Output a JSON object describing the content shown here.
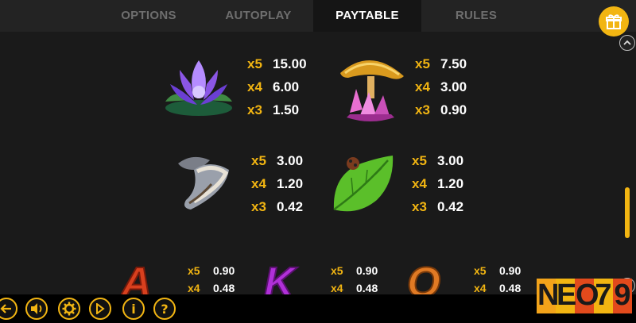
{
  "tabs": [
    {
      "label": "OPTIONS"
    },
    {
      "label": "AUTOPLAY"
    },
    {
      "label": "PAYTABLE",
      "active": true
    },
    {
      "label": "RULES"
    }
  ],
  "paytable": {
    "lotus": [
      {
        "m": "x5",
        "v": "15.00"
      },
      {
        "m": "x4",
        "v": "6.00"
      },
      {
        "m": "x3",
        "v": "1.50"
      }
    ],
    "mushroom": [
      {
        "m": "x5",
        "v": "7.50"
      },
      {
        "m": "x4",
        "v": "3.00"
      },
      {
        "m": "x3",
        "v": "0.90"
      }
    ],
    "shell": [
      {
        "m": "x5",
        "v": "3.00"
      },
      {
        "m": "x4",
        "v": "1.20"
      },
      {
        "m": "x3",
        "v": "0.42"
      }
    ],
    "leaf": [
      {
        "m": "x5",
        "v": "3.00"
      },
      {
        "m": "x4",
        "v": "1.20"
      },
      {
        "m": "x3",
        "v": "0.42"
      }
    ],
    "letter_a": [
      {
        "m": "x5",
        "v": "0.90"
      },
      {
        "m": "x4",
        "v": "0.48"
      }
    ],
    "letter_k": [
      {
        "m": "x5",
        "v": "0.90"
      },
      {
        "m": "x4",
        "v": "0.48"
      }
    ],
    "letter_q": [
      {
        "m": "x5",
        "v": "0.90"
      },
      {
        "m": "x4",
        "v": "0.48"
      }
    ]
  },
  "symbols": {
    "letter_a": "A",
    "letter_k": "K",
    "letter_q": "Q"
  },
  "controls": [
    {
      "icon": "back-arrow-icon"
    },
    {
      "icon": "sound-icon"
    },
    {
      "icon": "settings-gear-icon"
    },
    {
      "icon": "forward-arrow-icon"
    },
    {
      "icon": "info-icon",
      "glyph": "i"
    },
    {
      "icon": "help-icon",
      "glyph": "?"
    }
  ],
  "logo": {
    "text": "NEO79",
    "letters": [
      "N",
      "E",
      "O",
      "7",
      "9"
    ]
  },
  "colors": {
    "accent": "#f2b512",
    "background": "#1a1a1a",
    "tab_bar": "#232323"
  }
}
